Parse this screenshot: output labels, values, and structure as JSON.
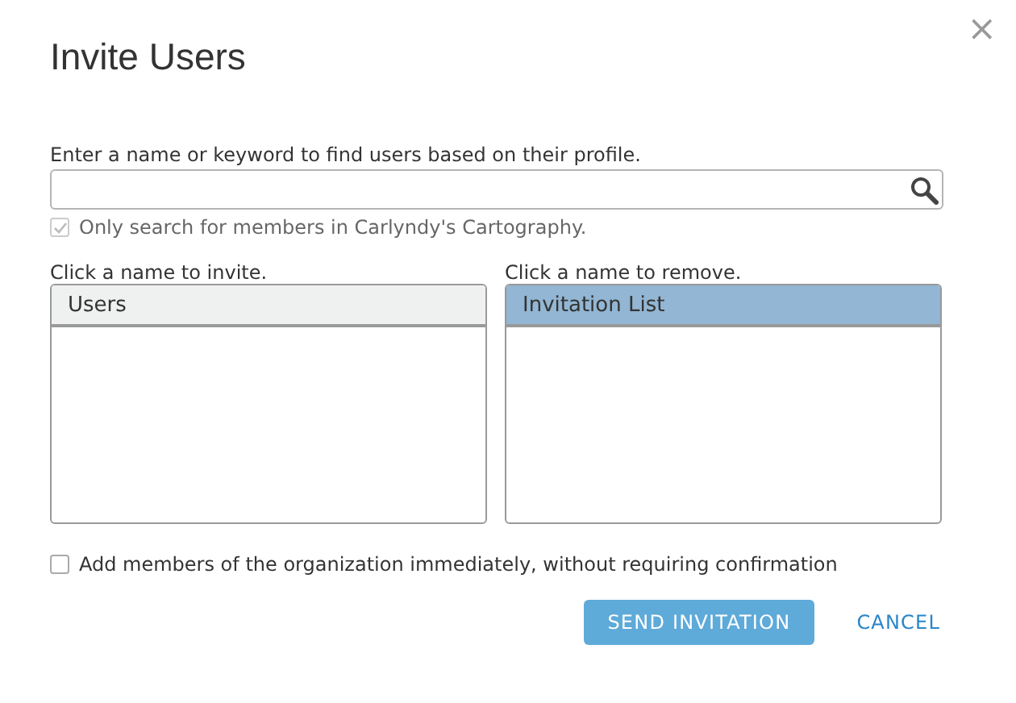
{
  "dialog": {
    "title": "Invite Users",
    "close": "×"
  },
  "search": {
    "label": "Enter a name or keyword to find users based on their profile."
  },
  "org_filter": {
    "label": "Only search for members in Carlyndy's Cartography.",
    "checked": true,
    "disabled": true
  },
  "lists": [
    {
      "hint": "Click a name to invite.",
      "header": "Users",
      "selected": false
    },
    {
      "hint": "Click a name to remove.",
      "header": "Invitation List",
      "selected": true
    }
  ],
  "add_immediately": {
    "label": "Add members of the organization immediately, without requiring confirmation",
    "checked": false,
    "disabled": false
  },
  "buttons": [
    {
      "kind": "primary",
      "label": "SEND INVITATION"
    },
    {
      "kind": "link",
      "label": "CANCEL"
    }
  ]
}
